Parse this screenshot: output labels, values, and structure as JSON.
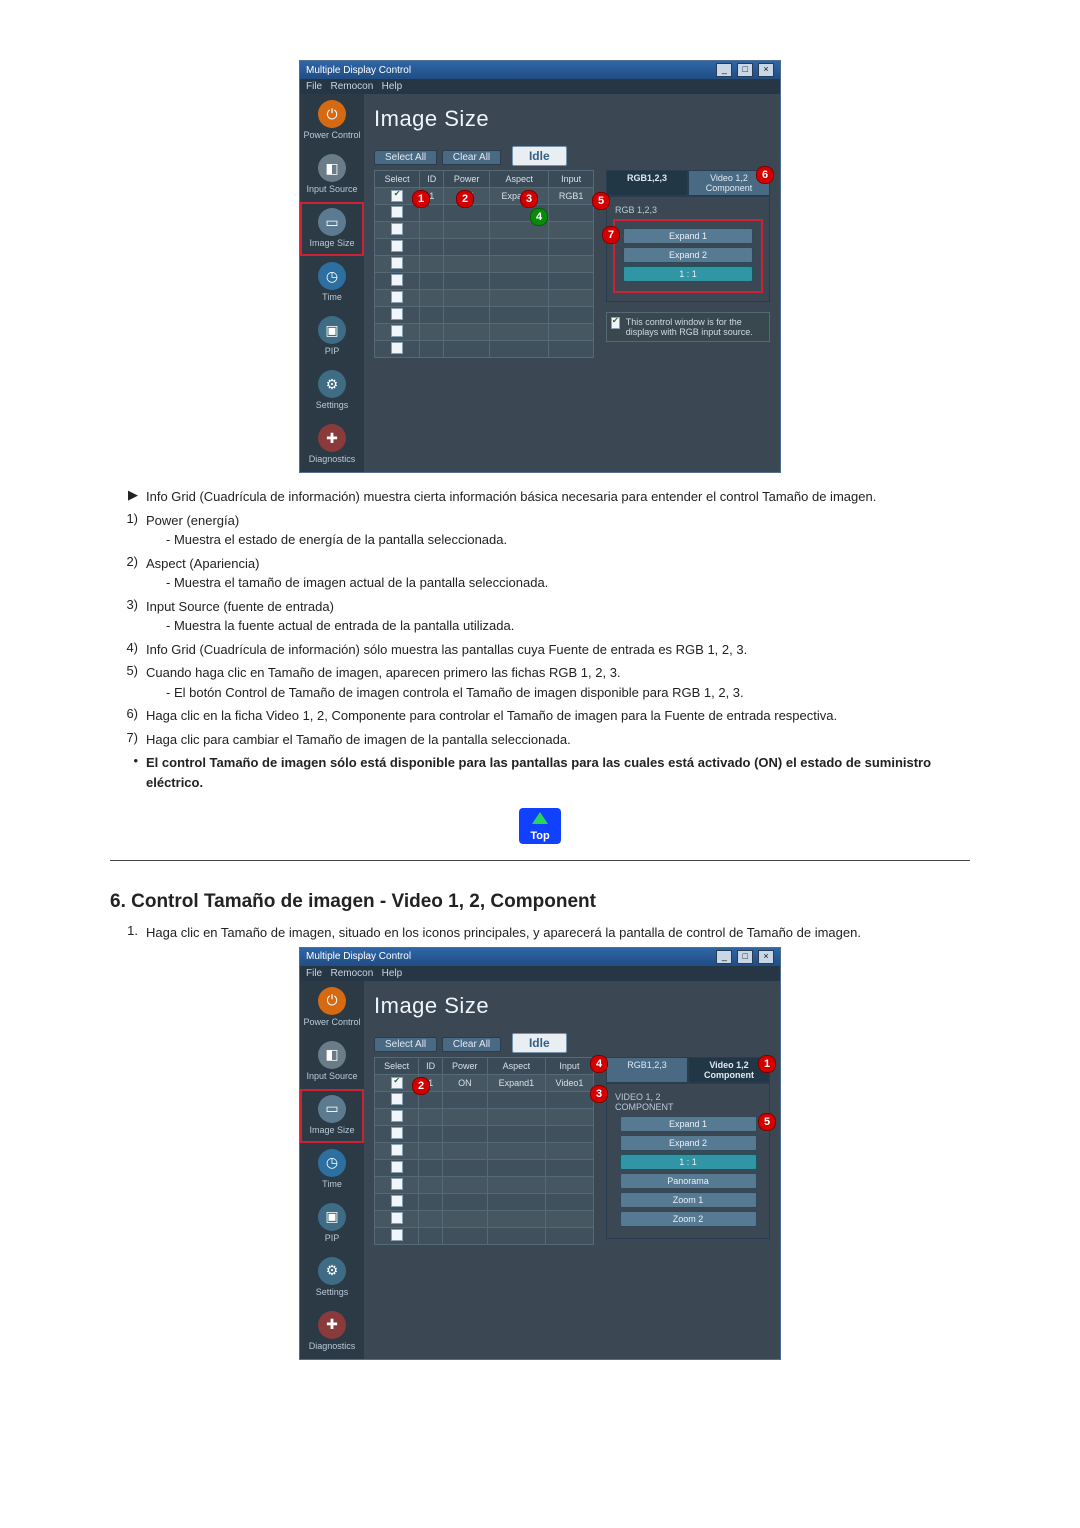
{
  "window": {
    "title": "Multiple Display Control",
    "menu": [
      "File",
      "Remocon",
      "Help"
    ],
    "heading": "Image Size",
    "select_all": "Select All",
    "clear_all": "Clear All",
    "idle": "Idle"
  },
  "sidebar": {
    "items": [
      {
        "label": "Power Control"
      },
      {
        "label": "Input Source"
      },
      {
        "label": "Image Size"
      },
      {
        "label": "Time"
      },
      {
        "label": "PIP"
      },
      {
        "label": "Settings"
      },
      {
        "label": "Diagnostics"
      }
    ]
  },
  "grid": {
    "headers": [
      "Select",
      "ID",
      "Power",
      "Aspect",
      "Input"
    ],
    "first_row_a": {
      "id": "1",
      "power": "ON",
      "aspect": "Expand1",
      "input": "RGB1"
    },
    "first_row_b": {
      "id": "1",
      "power": "ON",
      "aspect": "Expand1",
      "input": "Video1"
    }
  },
  "tabs_a": {
    "left": "RGB1,2,3",
    "right": "Video 1,2\nComponent",
    "label": "RGB 1,2,3",
    "options": [
      "Expand 1",
      "Expand 2",
      "1 : 1"
    ]
  },
  "tabs_b": {
    "left": "RGB1,2,3",
    "right": "Video 1,2\nComponent",
    "label": "VIDEO 1, 2\nCOMPONENT",
    "options": [
      "Expand 1",
      "Expand 2",
      "1 : 1",
      "Panorama",
      "Zoom 1",
      "Zoom 2"
    ]
  },
  "note": "This control window is for the displays with RGB input source.",
  "doc": {
    "p0": "Info Grid (Cuadrícula de información) muestra cierta información básica necesaria para entender el control Tamaño de imagen.",
    "p1a": "Power (energía)",
    "p1b": "- Muestra el estado de energía de la pantalla seleccionada.",
    "p2a": "Aspect (Apariencia)",
    "p2b": "- Muestra el tamaño de imagen actual de la pantalla seleccionada.",
    "p3a": "Input Source (fuente de entrada)",
    "p3b": "- Muestra la fuente actual de entrada de la pantalla utilizada.",
    "p4": "Info Grid (Cuadrícula de información) sólo muestra las pantallas cuya Fuente de entrada es RGB 1, 2, 3.",
    "p5a": "Cuando haga clic en Tamaño de imagen, aparecen primero las fichas RGB 1, 2, 3.",
    "p5b": "- El botón Control de Tamaño de imagen controla el Tamaño de imagen disponible para RGB 1, 2, 3.",
    "p6": "Haga clic en la ficha Video 1, 2, Componente para controlar el Tamaño de imagen para la Fuente de entrada respectiva.",
    "p7": "Haga clic para cambiar el Tamaño de imagen de la pantalla seleccionada.",
    "p8": "El control Tamaño de imagen sólo está disponible para las pantallas para las cuales está activado (ON) el estado de suministro eléctrico.",
    "top": "Top",
    "h2": "6. Control Tamaño de imagen - Video 1, 2, Component",
    "s1": "Haga clic en Tamaño de imagen, situado en los iconos principales, y aparecerá la pantalla de control de Tamaño de imagen."
  }
}
